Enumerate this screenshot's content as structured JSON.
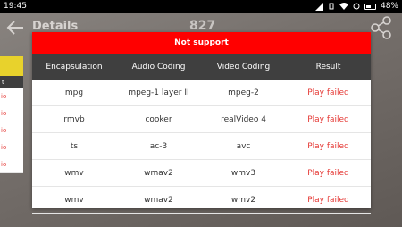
{
  "status_bar": {
    "time": "19:45",
    "battery": "48%"
  },
  "toolbar": {
    "title": "Details",
    "count": "827"
  },
  "left_panel": {
    "header": "t",
    "rows": [
      "io",
      "io",
      "io",
      "io",
      "io"
    ]
  },
  "dialog": {
    "title": "Not support",
    "columns": [
      "Encapsulation",
      "Audio Coding",
      "Video Coding",
      "Result"
    ],
    "rows": [
      [
        "mpg",
        "mpeg-1 layer II",
        "mpeg-2",
        "Play failed"
      ],
      [
        "rmvb",
        "cooker",
        "realVideo 4",
        "Play failed"
      ],
      [
        "ts",
        "ac-3",
        "avc",
        "Play failed"
      ],
      [
        "wmv",
        "wmav2",
        "wmv3",
        "Play failed"
      ],
      [
        "wmv",
        "wmav2",
        "wmv2",
        "Play failed"
      ]
    ]
  },
  "colors": {
    "header_red": "#ff0000",
    "failed_red": "#e53935",
    "table_header": "#3f3f3f"
  }
}
